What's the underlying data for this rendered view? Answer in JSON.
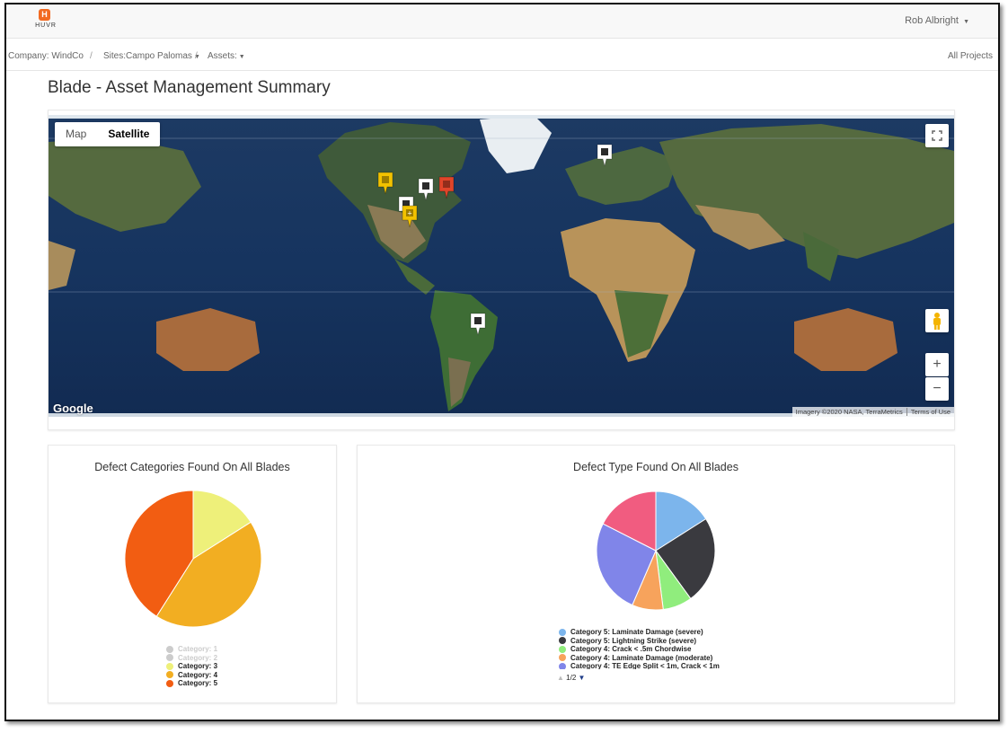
{
  "header": {
    "logo_text": "HUVR",
    "user_name": "Rob Albright"
  },
  "breadcrumb": {
    "company": "Company: WindCo",
    "sites": "Sites:Campo Palomas",
    "assets": "Assets:",
    "separator": "/",
    "all_projects": "All Projects"
  },
  "page": {
    "title": "Blade - Asset Management Summary"
  },
  "map": {
    "type_map": "Map",
    "type_satellite": "Satellite",
    "selected_type": "Satellite",
    "google_label": "Google",
    "imagery": "Imagery ©2020 NASA, TerraMetrics",
    "terms": "Terms of Use",
    "zoom_in": "+",
    "zoom_out": "−",
    "markers": [
      {
        "color": "#f2c200",
        "label": ""
      },
      {
        "color": "#ffffff",
        "label": ""
      },
      {
        "color": "#f2c200",
        "label": "+"
      },
      {
        "color": "#ffffff",
        "label": ""
      },
      {
        "color": "#e0452a",
        "label": ""
      },
      {
        "color": "#ffffff",
        "label": ""
      },
      {
        "color": "#ffffff",
        "label": ""
      }
    ]
  },
  "categories_chart": {
    "title": "Defect Categories Found On All Blades",
    "legend": [
      {
        "label": "Category: 1",
        "color": "#cccccc",
        "muted": true
      },
      {
        "label": "Category: 2",
        "color": "#cccccc",
        "muted": true
      },
      {
        "label": "Category: 3",
        "color": "#eef07a",
        "muted": false
      },
      {
        "label": "Category: 4",
        "color": "#f2ae22",
        "muted": false
      },
      {
        "label": "Category: 5",
        "color": "#f25d12",
        "muted": false
      }
    ]
  },
  "types_chart": {
    "title": "Defect Type Found On All Blades",
    "legend": [
      {
        "label": "Category 5: Laminate Damage (severe)",
        "color": "#7cb5ec"
      },
      {
        "label": "Category 5: Lightning Strike (severe)",
        "color": "#3a3a3f"
      },
      {
        "label": "Category 4: Crack < .5m Chordwise",
        "color": "#90ed7d"
      },
      {
        "label": "Category 4: Laminate Damage (moderate)",
        "color": "#f7a35c"
      },
      {
        "label": "Category 4: TE Edge Split < 1m, Crack < 1m",
        "color": "#8085e9"
      }
    ],
    "pager": "1/2"
  },
  "chart_data": [
    {
      "type": "pie",
      "title": "Defect Categories Found On All Blades",
      "categories": [
        "Category: 3",
        "Category: 4",
        "Category: 5"
      ],
      "values": [
        16,
        43,
        41
      ],
      "colors": [
        "#eef07a",
        "#f2ae22",
        "#f25d12"
      ]
    },
    {
      "type": "pie",
      "title": "Defect Type Found On All Blades",
      "categories": [
        "Category 5: Laminate Damage (severe)",
        "Category 5: Lightning Strike (severe)",
        "Category 4: Crack < .5m Chordwise",
        "Category 4: Laminate Damage (moderate)",
        "Category 4: TE Edge Split < 1m, Crack < 1m",
        ""
      ],
      "values": [
        16,
        24,
        8,
        8.5,
        26,
        17.5
      ],
      "colors": [
        "#7cb5ec",
        "#3a3a3f",
        "#90ed7d",
        "#f7a35c",
        "#8085e9",
        "#f15c80"
      ]
    }
  ]
}
